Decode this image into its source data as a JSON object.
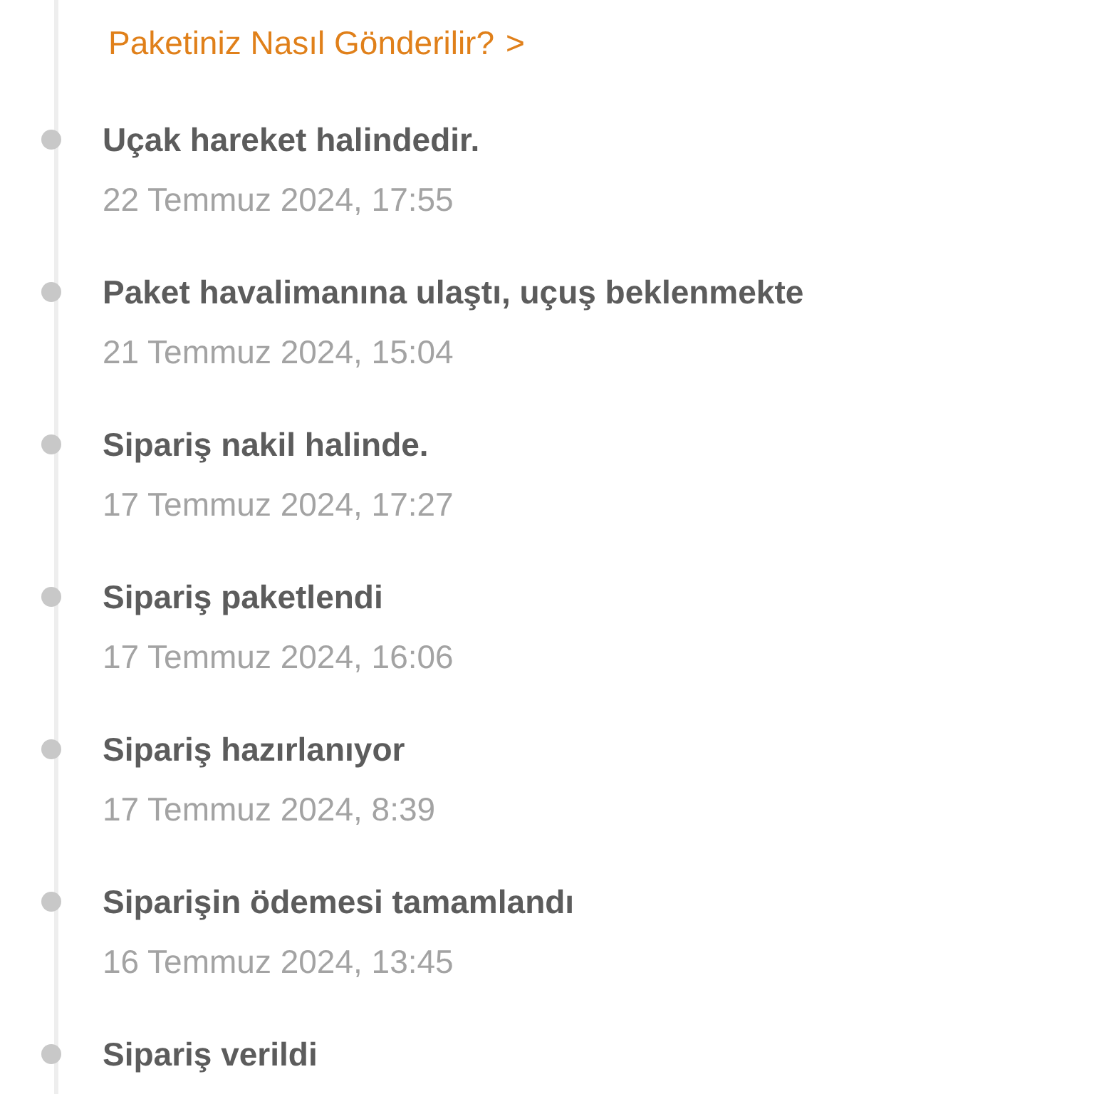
{
  "link": {
    "label": "Paketiniz Nasıl Gönderilir?",
    "chevron": ">"
  },
  "events": [
    {
      "title": "Uçak hareket halindedir.",
      "time": "22 Temmuz 2024, 17:55"
    },
    {
      "title": "Paket havalimanına ulaştı, uçuş beklenmekte",
      "time": "21 Temmuz 2024, 15:04"
    },
    {
      "title": "Sipariş nakil halinde.",
      "time": "17 Temmuz 2024, 17:27"
    },
    {
      "title": "Sipariş paketlendi",
      "time": "17 Temmuz 2024, 16:06"
    },
    {
      "title": "Sipariş hazırlanıyor",
      "time": "17 Temmuz 2024, 8:39"
    },
    {
      "title": "Siparişin ödemesi tamamlandı",
      "time": "16 Temmuz 2024, 13:45"
    },
    {
      "title": "Sipariş verildi"
    }
  ]
}
